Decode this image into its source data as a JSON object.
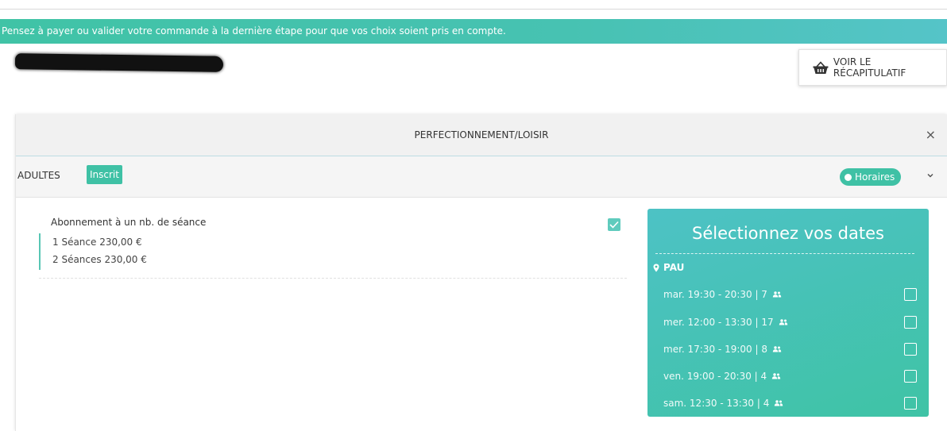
{
  "banner": {
    "text": "Pensez à payer ou valider votre commande à la dernière étape pour que vos choix soient pris en compte."
  },
  "recap_button": {
    "label": "VOIR LE RÉCAPITULATIF",
    "icon": "basket-icon"
  },
  "panel": {
    "title": "PERFECTIONNEMENT/LOISIR",
    "close": "×",
    "category": "ADULTES",
    "status_badge": "Inscrit",
    "schedule_toggle": "Horaires"
  },
  "offer": {
    "title": "Abonnement à un nb. de séance",
    "lines": [
      "1 Séance 230,00 €",
      "2 Séances 230,00 €"
    ],
    "checked": true
  },
  "dates": {
    "title": "Sélectionnez vos dates",
    "location": "PAU",
    "slots": [
      {
        "label": "mar. 19:30 - 20:30  |  7"
      },
      {
        "label": "mer. 12:00 - 13:30  |  17"
      },
      {
        "label": "mer. 17:30 - 19:00  |  8"
      },
      {
        "label": "ven. 19:00 - 20:30  |  4"
      },
      {
        "label": "sam. 12:30 - 13:30  |  4"
      }
    ]
  },
  "colors": {
    "accent": "#3fc1a5",
    "accent_alt": "#4dc2c5"
  }
}
